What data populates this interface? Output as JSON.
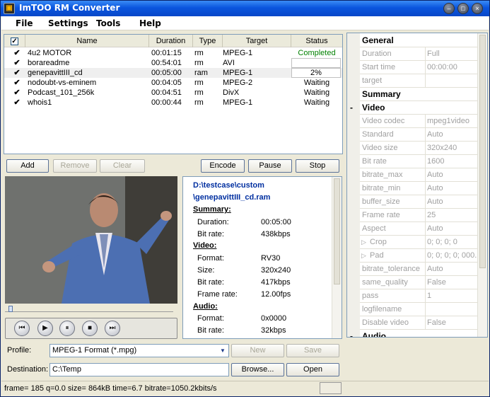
{
  "window": {
    "title": "ImTOO RM Converter"
  },
  "menu": [
    "File",
    "Settings",
    "Tools",
    "Help"
  ],
  "list": {
    "headers": {
      "name": "Name",
      "duration": "Duration",
      "type": "Type",
      "target": "Target",
      "status": "Status"
    },
    "rows": [
      {
        "name": "4u2 MOTOR",
        "duration": "00:01:15",
        "type": "rm",
        "target": "MPEG-1",
        "status": "Completed"
      },
      {
        "name": "borareadme",
        "duration": "00:54:01",
        "type": "rm",
        "target": "AVI",
        "status": ""
      },
      {
        "name": "genepavittIII_cd",
        "duration": "00:05:00",
        "type": "ram",
        "target": "MPEG-1",
        "status": "2%"
      },
      {
        "name": "nodoubt-vs-eminem",
        "duration": "00:04:05",
        "type": "rm",
        "target": "MPEG-2",
        "status": "Waiting"
      },
      {
        "name": "Podcast_101_256k",
        "duration": "00:04:51",
        "type": "rm",
        "target": "DivX",
        "status": "Waiting"
      },
      {
        "name": "whois1",
        "duration": "00:00:44",
        "type": "rm",
        "target": "MPEG-1",
        "status": "Waiting"
      }
    ]
  },
  "buttons": {
    "add": "Add",
    "remove": "Remove",
    "clear": "Clear",
    "encode": "Encode",
    "pause": "Pause",
    "stop": "Stop",
    "new": "New",
    "save": "Save",
    "browse": "Browse...",
    "open": "Open"
  },
  "info": {
    "path1": "D:\\testcase\\custom",
    "path2": "\\genepavittIII_cd.ram",
    "summary": {
      "heading": "Summary:",
      "duration_label": "Duration:",
      "duration": "00:05:00",
      "bitrate_label": "Bit rate:",
      "bitrate": "438kbps"
    },
    "video": {
      "heading": "Video:",
      "format_label": "Format:",
      "format": "RV30",
      "size_label": "Size:",
      "size": "320x240",
      "bitrate_label": "Bit rate:",
      "bitrate": "417kbps",
      "framerate_label": "Frame rate:",
      "framerate": "12.00fps"
    },
    "audio": {
      "heading": "Audio:",
      "format_label": "Format:",
      "format": "0x0000",
      "bitrate_label": "Bit rate:",
      "bitrate": "32kbps"
    }
  },
  "profile": {
    "label": "Profile:",
    "value": "MPEG-1 Format  (*.mpg)"
  },
  "destination": {
    "label": "Destination:",
    "value": "C:\\Temp"
  },
  "status_text": "frame=  185 q=0.0 size=     864kB time=6.7 bitrate=1050.2kbits/s",
  "properties": [
    {
      "key": "General",
      "value": "",
      "category": true,
      "sign": ""
    },
    {
      "key": "Duration",
      "value": "Full"
    },
    {
      "key": "Start time",
      "value": "00:00:00"
    },
    {
      "key": "target",
      "value": ""
    },
    {
      "key": "Summary",
      "value": "",
      "category": true,
      "sign": ""
    },
    {
      "key": "Video",
      "value": "",
      "category": true,
      "sign": "-"
    },
    {
      "key": "Video codec",
      "value": "mpeg1video"
    },
    {
      "key": "Standard",
      "value": "Auto"
    },
    {
      "key": "Video size",
      "value": "320x240"
    },
    {
      "key": "Bit rate",
      "value": "1600"
    },
    {
      "key": "bitrate_max",
      "value": "Auto"
    },
    {
      "key": "bitrate_min",
      "value": "Auto"
    },
    {
      "key": "buffer_size",
      "value": "Auto"
    },
    {
      "key": "Frame rate",
      "value": "25"
    },
    {
      "key": "Aspect",
      "value": "Auto"
    },
    {
      "key": "Crop",
      "value": "0; 0; 0; 0",
      "expand": true
    },
    {
      "key": "Pad",
      "value": "0; 0; 0; 0; 000...",
      "expand": true
    },
    {
      "key": "bitrate_tolerance",
      "value": "Auto"
    },
    {
      "key": "same_quality",
      "value": "False"
    },
    {
      "key": "pass",
      "value": "1"
    },
    {
      "key": "logfilename",
      "value": ""
    },
    {
      "key": "Disable video",
      "value": "False"
    },
    {
      "key": "Audio",
      "value": "",
      "category": true,
      "sign": "-"
    }
  ],
  "colors": {
    "title_bar": "#0a55de",
    "completed_text": "#008000",
    "info_path": "#002fa0"
  }
}
